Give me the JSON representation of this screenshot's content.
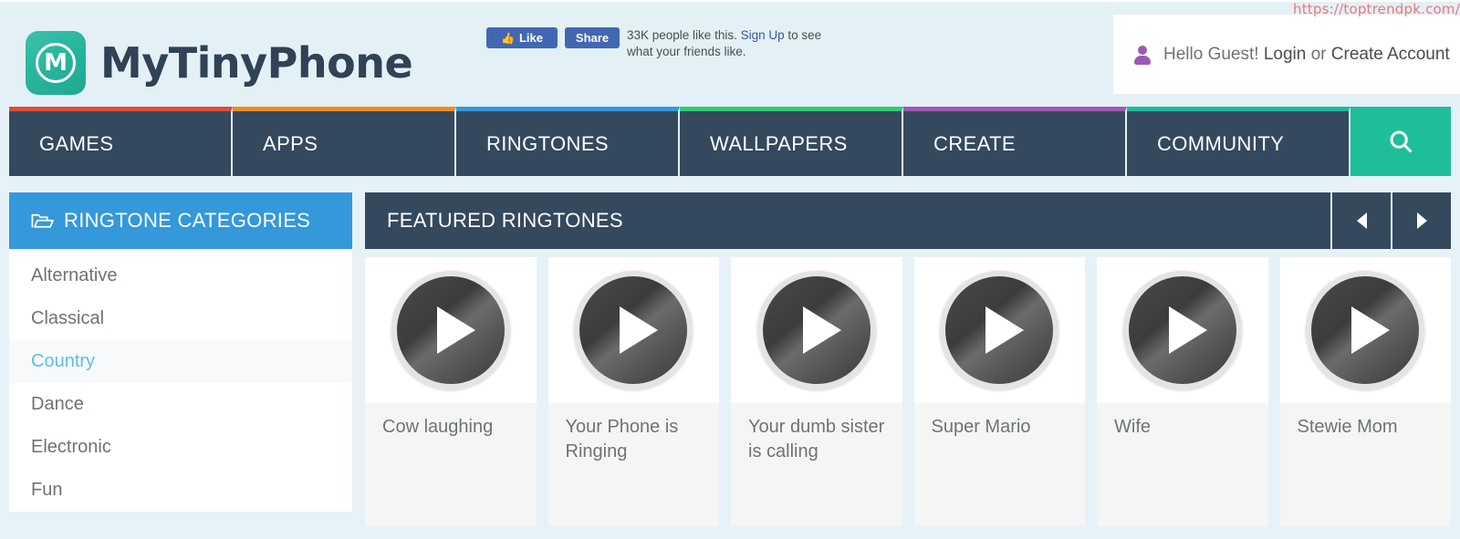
{
  "watermark": {
    "url": "https://toptrendpk.com/"
  },
  "header": {
    "logo": {
      "text": "MyTinyPhone",
      "mark_letter": "M",
      "icon": "mytinyphone-logo-icon"
    },
    "facebook": {
      "like_label": "Like",
      "share_label": "Share",
      "thumb_icon": "thumbs-up-icon",
      "count_text": "33K people like this.",
      "signup_link": "Sign Up",
      "tail_text": " to see",
      "second_line": "what your friends like.",
      "brand_color": "#4267b2"
    },
    "account": {
      "user_icon": "user-avatar-icon",
      "greeting": "Hello Guest!",
      "login_label": "Login",
      "or_label": "or",
      "create_label": "Create Account"
    }
  },
  "nav": {
    "items": [
      {
        "label": "GAMES",
        "accent": "#e04b3c"
      },
      {
        "label": "APPS",
        "accent": "#ed8b22"
      },
      {
        "label": "RINGTONES",
        "accent": "#3498db"
      },
      {
        "label": "WALLPAPERS",
        "accent": "#2ecc71"
      },
      {
        "label": "CREATE",
        "accent": "#9b59b6"
      },
      {
        "label": "COMMUNITY",
        "accent": "#1abc9c"
      }
    ],
    "search_icon": "search-icon",
    "bar_color": "#34495e",
    "search_color": "#1fbe9a"
  },
  "sidebar": {
    "header_title": "RINGTONE CATEGORIES",
    "header_icon": "folder-open-icon",
    "header_color": "#3498db",
    "active_color": "#5bc0de",
    "categories": [
      {
        "label": "Alternative",
        "active": false
      },
      {
        "label": "Classical",
        "active": false
      },
      {
        "label": "Country",
        "active": true
      },
      {
        "label": "Dance",
        "active": false
      },
      {
        "label": "Electronic",
        "active": false
      },
      {
        "label": "Fun",
        "active": false
      }
    ]
  },
  "main": {
    "panel_title": "FEATURED RINGTONES",
    "prev_label": "Previous",
    "next_label": "Next",
    "prev_icon": "chevron-left-icon",
    "next_icon": "chevron-right-icon",
    "cards": [
      {
        "title": "Cow laughing",
        "play_icon": "play-button-icon"
      },
      {
        "title": "Your Phone is Ringing",
        "play_icon": "play-button-icon"
      },
      {
        "title": "Your dumb sister is calling",
        "play_icon": "play-button-icon"
      },
      {
        "title": "Super Mario",
        "play_icon": "play-button-icon"
      },
      {
        "title": "Wife",
        "play_icon": "play-button-icon"
      },
      {
        "title": "Stewie Mom",
        "play_icon": "play-button-icon"
      }
    ]
  }
}
